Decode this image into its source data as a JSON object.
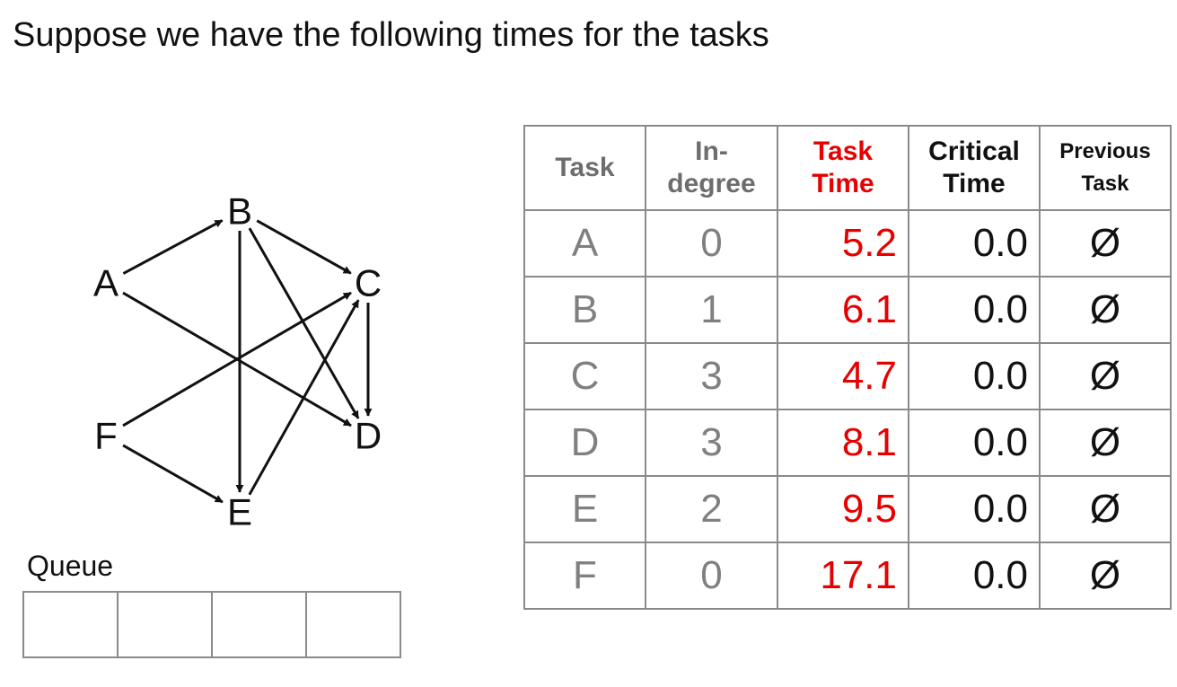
{
  "title": "Suppose we have the following times for the tasks",
  "graph": {
    "nodes": [
      {
        "id": "A",
        "label": "A"
      },
      {
        "id": "B",
        "label": "B"
      },
      {
        "id": "C",
        "label": "C"
      },
      {
        "id": "D",
        "label": "D"
      },
      {
        "id": "E",
        "label": "E"
      },
      {
        "id": "F",
        "label": "F"
      }
    ],
    "edges": [
      {
        "from": "A",
        "to": "B"
      },
      {
        "from": "A",
        "to": "D"
      },
      {
        "from": "B",
        "to": "C"
      },
      {
        "from": "B",
        "to": "D"
      },
      {
        "from": "B",
        "to": "E"
      },
      {
        "from": "C",
        "to": "D"
      },
      {
        "from": "F",
        "to": "C"
      },
      {
        "from": "F",
        "to": "E"
      },
      {
        "from": "E",
        "to": "C"
      }
    ]
  },
  "queue": {
    "label": "Queue",
    "slots": [
      "",
      "",
      "",
      ""
    ]
  },
  "table": {
    "headers": {
      "task": "Task",
      "indegree_line1": "In-",
      "indegree_line2": "degree",
      "task_time_line1": "Task",
      "task_time_line2": "Time",
      "critical_line1": "Critical",
      "critical_line2": "Time",
      "previous_line1": "Previous",
      "previous_line2": "Task"
    },
    "rows": [
      {
        "task": "A",
        "indegree": "0",
        "task_time": "5.2",
        "critical_time": "0.0",
        "previous": "Ø"
      },
      {
        "task": "B",
        "indegree": "1",
        "task_time": "6.1",
        "critical_time": "0.0",
        "previous": "Ø"
      },
      {
        "task": "C",
        "indegree": "3",
        "task_time": "4.7",
        "critical_time": "0.0",
        "previous": "Ø"
      },
      {
        "task": "D",
        "indegree": "3",
        "task_time": "8.1",
        "critical_time": "0.0",
        "previous": "Ø"
      },
      {
        "task": "E",
        "indegree": "2",
        "task_time": "9.5",
        "critical_time": "0.0",
        "previous": "Ø"
      },
      {
        "task": "F",
        "indegree": "0",
        "task_time": "17.1",
        "critical_time": "0.0",
        "previous": "Ø"
      }
    ]
  },
  "colors": {
    "task_time": "#e60000",
    "muted_text": "#808080",
    "grid_line": "#8a8a8a",
    "edge": "#111111"
  }
}
